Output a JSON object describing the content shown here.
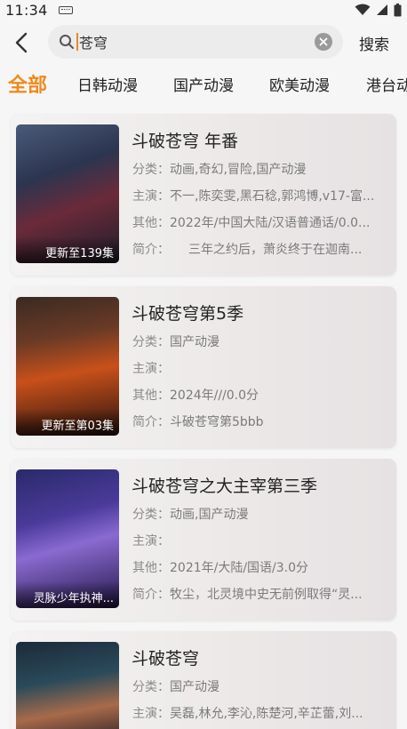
{
  "status": {
    "time": "11:34"
  },
  "search": {
    "value": "苍穹",
    "button_label": "搜索"
  },
  "tabs": [
    {
      "label": "全部",
      "active": true
    },
    {
      "label": "日韩动漫",
      "active": false
    },
    {
      "label": "国产动漫",
      "active": false
    },
    {
      "label": "欧美动漫",
      "active": false
    },
    {
      "label": "港台动",
      "active": false
    }
  ],
  "results": [
    {
      "title": "斗破苍穹 年番",
      "badge": "更新至139集",
      "category_label": "分类：",
      "category": "动画,奇幻,冒险,国产动漫",
      "cast_label": "主演：",
      "cast": "不一,陈奕雯,黑石稔,郭鸿博,v17-富...",
      "other_label": "其他：",
      "other": "2022年/中国大陆/汉语普通话/0.0...",
      "intro_label": "简介：",
      "intro": "　　三年之约后，萧炎终于在迦南..."
    },
    {
      "title": "斗破苍穹第5季",
      "badge": "更新至第03集",
      "category_label": "分类：",
      "category": "国产动漫",
      "cast_label": "主演：",
      "cast": "",
      "other_label": "其他：",
      "other": "2024年///0.0分",
      "intro_label": "简介：",
      "intro": "斗破苍穹第5bbb"
    },
    {
      "title": "斗破苍穹之大主宰第三季",
      "badge": "灵脉少年执神...",
      "category_label": "分类：",
      "category": "动画,国产动漫",
      "cast_label": "主演：",
      "cast": "",
      "other_label": "其他：",
      "other": "2021年/大陆/国语/3.0分",
      "intro_label": "简介：",
      "intro": "牧尘，北灵境中史无前例取得“灵..."
    },
    {
      "title": "斗破苍穹",
      "badge": "",
      "category_label": "分类：",
      "category": "国产动漫",
      "cast_label": "主演：",
      "cast": "吴磊,林允,李沁,陈楚河,辛芷蕾,刘..."
    }
  ],
  "colors": {
    "accent": "#ef8a1c",
    "background": "#f6f6f6"
  },
  "icons": [
    "keyboard-icon",
    "wifi-icon",
    "signal-icon",
    "battery-icon",
    "back-arrow-icon",
    "search-icon",
    "clear-icon"
  ]
}
